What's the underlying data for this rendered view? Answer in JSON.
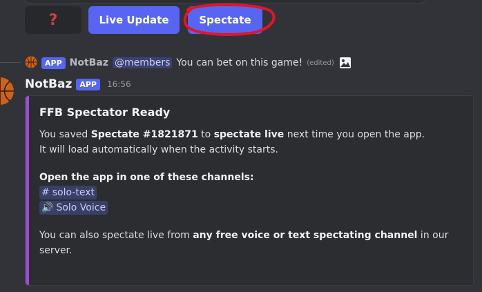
{
  "buttons": {
    "question": "?",
    "live_update": "Live Update",
    "spectate": "Spectate"
  },
  "reply": {
    "badge": "APP",
    "author": "NotBaz",
    "mention": "@members",
    "text": "You can bet on this game!",
    "edited": "(edited)"
  },
  "message": {
    "author": "NotBaz",
    "badge": "APP",
    "time": "16:56"
  },
  "embed": {
    "title": "FFB Spectator Ready",
    "line1_pre": "You saved ",
    "line1_b1": "Spectate #1821871",
    "line1_mid": " to ",
    "line1_b2": "spectate live",
    "line1_post": " next time you open the app.",
    "line2": "It will load automatically when the activity starts.",
    "channels_heading": "Open the app in one of these channels:",
    "channels": [
      {
        "icon": "#",
        "name": "solo-text"
      },
      {
        "icon": "🔊",
        "name": "Solo Voice"
      }
    ],
    "footer_pre": "You can also spectate live from ",
    "footer_b": "any free voice or text spectating channel",
    "footer_post": " in our server."
  },
  "colors": {
    "background": "#323339",
    "blurple": "#5865f2",
    "embed_accent": "#9b4dd8",
    "annotation": "#e0162b"
  },
  "icons": {
    "question": "question-mark-icon",
    "image": "image-icon",
    "text_channel": "hash-icon",
    "voice_channel": "speaker-icon"
  }
}
